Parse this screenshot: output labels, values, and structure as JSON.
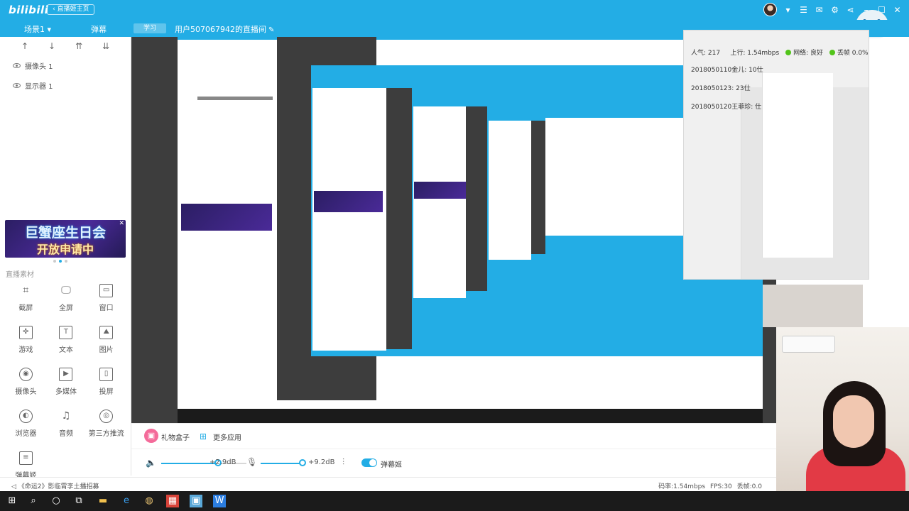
{
  "app": {
    "brand": "bilibili",
    "home_button": "直播姬主页"
  },
  "titlebar_icons": [
    "avatar",
    "menu-icon",
    "minimize-icon",
    "mail-icon",
    "settings-icon",
    "share-icon",
    "minimize-window-icon",
    "maximize-window-icon",
    "close-icon"
  ],
  "scenebar": {
    "scene": "场景1",
    "tab_danmu": "弹幕",
    "study_button": "学习",
    "room_title": "用户507067942的直播间"
  },
  "sidebar": {
    "sources": [
      {
        "label": "摄像头 1"
      },
      {
        "label": "显示器 1"
      }
    ],
    "banner": {
      "line1": "巨蟹座生日会",
      "line2": "开放申请中"
    },
    "materials_title": "直播素材",
    "tools": [
      {
        "label": "截屏",
        "icon": "crop-icon"
      },
      {
        "label": "全屏",
        "icon": "monitor-icon"
      },
      {
        "label": "窗口",
        "icon": "window-icon"
      },
      {
        "label": "游戏",
        "icon": "gamepad-icon"
      },
      {
        "label": "文本",
        "icon": "text-icon"
      },
      {
        "label": "图片",
        "icon": "image-icon"
      },
      {
        "label": "摄像头",
        "icon": "camera-icon"
      },
      {
        "label": "多媒体",
        "icon": "media-file-icon"
      },
      {
        "label": "投屏",
        "icon": "phone-icon"
      },
      {
        "label": "浏览器",
        "icon": "browser-icon"
      },
      {
        "label": "音频",
        "icon": "music-icon"
      },
      {
        "label": "第三方推流",
        "icon": "stream-icon"
      },
      {
        "label": "弹幕姬",
        "icon": "danmaku-icon"
      }
    ]
  },
  "bottom": {
    "gift_box": "礼物盒子",
    "more_apps": "更多应用",
    "speaker_gain": "+2.9dB",
    "speaker_level": 0.67,
    "mic_gain": "+9.2dB",
    "mic_level": 0.98,
    "danmu_toggle": "弹幕姬"
  },
  "status": {
    "game": "《命运2》影临霄李土播招募",
    "bitrate": "码率:1.54mbps",
    "fps": "FPS:30",
    "drop": "丢帧:0.0"
  },
  "overlay": {
    "popularity": "人气: 217",
    "upload": "上行: 1.54mbps",
    "network": "网络: 良好",
    "dropped": "丢帧 0.0%",
    "lines": [
      "2018050110金儿: 10仕",
      "2018050123: 23仕",
      "2018050120王菲珍: 仕"
    ]
  },
  "accent_color": "#23ade5"
}
